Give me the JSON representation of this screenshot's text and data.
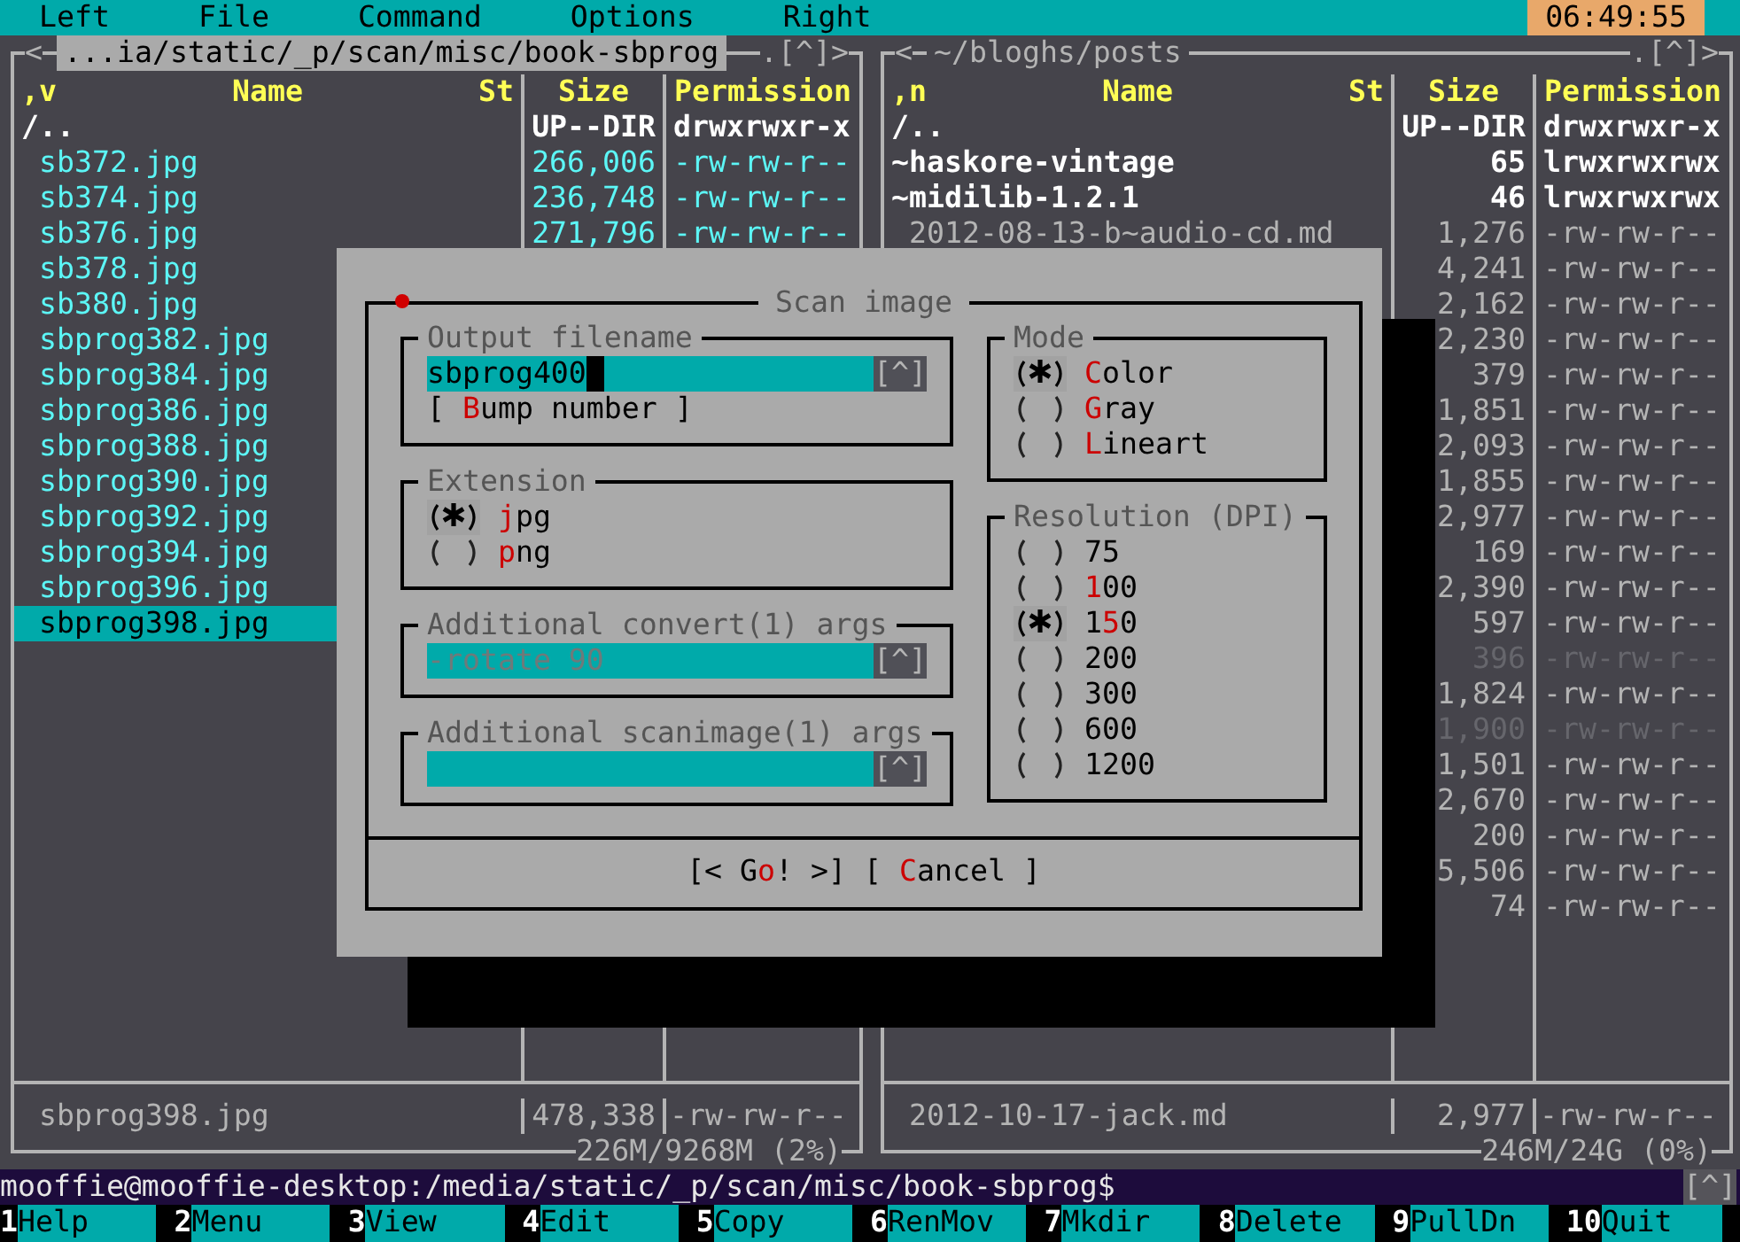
{
  "menu_bar": {
    "items": [
      "Left",
      "File",
      "Command",
      "Options",
      "Right"
    ],
    "clock": "06:49:55"
  },
  "panels": [
    {
      "active": true,
      "left_marker": "<",
      "path": "...ia/static/_p/scan/misc/book-sbprog",
      "right_marker": ".[^]>",
      "columns": {
        "sort": ",v",
        "name": "Name",
        "status": "St",
        "size": "Size",
        "permission": "Permission"
      },
      "rows": [
        {
          "kind": "dir",
          "name": "/..",
          "size": "UP--DIR",
          "permission": "drwxrwxr-x",
          "selected": false
        },
        {
          "kind": "image",
          "name": "sb372.jpg",
          "size": "266,006",
          "permission": "-rw-rw-r--",
          "selected": false
        },
        {
          "kind": "image",
          "name": "sb374.jpg",
          "size": "236,748",
          "permission": "-rw-rw-r--",
          "selected": false
        },
        {
          "kind": "image",
          "name": "sb376.jpg",
          "size": "271,796",
          "permission": "-rw-rw-r--",
          "selected": false
        },
        {
          "kind": "image",
          "name": "sb378.jpg",
          "selected": false
        },
        {
          "kind": "image",
          "name": "sb380.jpg",
          "selected": false
        },
        {
          "kind": "image",
          "name": "sbprog382.jpg",
          "selected": false
        },
        {
          "kind": "image",
          "name": "sbprog384.jpg",
          "selected": false
        },
        {
          "kind": "image",
          "name": "sbprog386.jpg",
          "selected": false
        },
        {
          "kind": "image",
          "name": "sbprog388.jpg",
          "selected": false
        },
        {
          "kind": "image",
          "name": "sbprog390.jpg",
          "selected": false
        },
        {
          "kind": "image",
          "name": "sbprog392.jpg",
          "selected": false
        },
        {
          "kind": "image",
          "name": "sbprog394.jpg",
          "selected": false
        },
        {
          "kind": "image",
          "name": "sbprog396.jpg",
          "selected": false
        },
        {
          "kind": "image",
          "name": "sbprog398.jpg",
          "selected": true
        }
      ],
      "info": {
        "name": "sbprog398.jpg",
        "size": "478,338",
        "permission": "-rw-rw-r--"
      },
      "disk_usage": "226M/9268M (2%)"
    },
    {
      "active": false,
      "left_marker": "<",
      "path": "~/bloghs/posts",
      "right_marker": ".[^]>",
      "columns": {
        "sort": ",n",
        "name": "Name",
        "status": "St",
        "size": "Size",
        "permission": "Permission"
      },
      "rows": [
        {
          "kind": "dir",
          "name": "/..",
          "size": "UP--DIR",
          "permission": "drwxrwxr-x",
          "selected": false
        },
        {
          "kind": "link",
          "name": "~haskore-vintage",
          "size": "65",
          "permission": "lrwxrwxrwx",
          "selected": false
        },
        {
          "kind": "link",
          "name": "~midilib-1.2.1",
          "size": "46",
          "permission": "lrwxrwxrwx",
          "selected": false
        },
        {
          "kind": "doc",
          "name": "2012-08-13-b~audio-cd.md",
          "size": "1,276",
          "permission": "-rw-rw-r--",
          "selected": false
        },
        {
          "kind": "doc",
          "size": "4,241",
          "permission": "-rw-rw-r--",
          "selected": false
        },
        {
          "kind": "doc",
          "size": "2,162",
          "permission": "-rw-rw-r--",
          "selected": false
        },
        {
          "kind": "doc",
          "size": "2,230",
          "permission": "-rw-rw-r--",
          "selected": false
        },
        {
          "kind": "doc",
          "size": "379",
          "permission": "-rw-rw-r--",
          "selected": false
        },
        {
          "kind": "doc",
          "size": "1,851",
          "permission": "-rw-rw-r--",
          "selected": false
        },
        {
          "kind": "doc",
          "size": "2,093",
          "permission": "-rw-rw-r--",
          "selected": false
        },
        {
          "kind": "doc",
          "size": "1,855",
          "permission": "-rw-rw-r--",
          "selected": false
        },
        {
          "kind": "doc",
          "size": "2,977",
          "permission": "-rw-rw-r--",
          "selected": false
        },
        {
          "kind": "doc",
          "size": "169",
          "permission": "-rw-rw-r--",
          "selected": false
        },
        {
          "kind": "doc",
          "size": "2,390",
          "permission": "-rw-rw-r--",
          "selected": false
        },
        {
          "kind": "doc",
          "size": "597",
          "permission": "-rw-rw-r--",
          "selected": false
        },
        {
          "kind": "backup",
          "size": "396",
          "permission": "-rw-rw-r--",
          "selected": false
        },
        {
          "kind": "doc",
          "size": "1,824",
          "permission": "-rw-rw-r--",
          "selected": false
        },
        {
          "kind": "backup",
          "size": "1,900",
          "permission": "-rw-rw-r--",
          "selected": false
        },
        {
          "kind": "doc",
          "size": "1,501",
          "permission": "-rw-rw-r--",
          "selected": false
        },
        {
          "kind": "doc",
          "size": "2,670",
          "permission": "-rw-rw-r--",
          "selected": false
        },
        {
          "kind": "doc",
          "size": "200",
          "permission": "-rw-rw-r--",
          "selected": false
        },
        {
          "kind": "doc",
          "size": "5,506",
          "permission": "-rw-rw-r--",
          "selected": false
        },
        {
          "kind": "doc",
          "size": "74",
          "permission": "-rw-rw-r--",
          "selected": false
        }
      ],
      "info": {
        "name": "2012-10-17-jack.md",
        "size": "2,977",
        "permission": "-rw-rw-r--"
      },
      "disk_usage": "246M/24G (0%)"
    }
  ],
  "dialog": {
    "title": "Scan image",
    "columns": [
      {
        "sections": [
          {
            "kind": "input",
            "title": "Output filename",
            "value": "sbprog400",
            "focused": true,
            "disabled": false,
            "history_button": "[^]",
            "button": {
              "pre": "[ ",
              "key": "B",
              "post": "ump number ]"
            }
          },
          {
            "kind": "radio",
            "title": "Extension",
            "options": [
              {
                "key": "j",
                "post": "pg",
                "selected": true
              },
              {
                "key": "p",
                "post": "ng",
                "selected": false
              }
            ]
          },
          {
            "kind": "input",
            "title": "Additional convert(1) args",
            "value": "-rotate 90",
            "focused": false,
            "disabled": true,
            "history_button": "[^]"
          },
          {
            "kind": "input",
            "title": "Additional scanimage(1) args",
            "focused": false,
            "history_button": "[^]"
          }
        ]
      },
      {
        "sections": [
          {
            "kind": "radio",
            "title": "Mode",
            "options": [
              {
                "key": "C",
                "post": "olor",
                "selected": true
              },
              {
                "key": "G",
                "post": "ray",
                "selected": false
              },
              {
                "key": "L",
                "post": "ineart",
                "selected": false
              }
            ]
          },
          {
            "kind": "radio",
            "title": "Resolution (DPI)",
            "options": [
              {
                "pre": "75",
                "selected": false
              },
              {
                "key": "1",
                "post": "00",
                "selected": false
              },
              {
                "pre": "1",
                "key": "5",
                "post": "0",
                "selected": true
              },
              {
                "pre": "200",
                "selected": false
              },
              {
                "pre": "300",
                "selected": false
              },
              {
                "pre": "600",
                "selected": false
              },
              {
                "pre": "1200",
                "selected": false
              }
            ]
          }
        ]
      }
    ],
    "buttons": [
      {
        "pre": "[< G",
        "key": "o",
        "post": "! >]"
      },
      {
        "pre": "[ ",
        "key": "C",
        "post": "ancel ]"
      }
    ]
  },
  "command_line": {
    "prompt": "mooffie@mooffie-desktop:/media/static/_p/scan/misc/book-sbprog$",
    "history_button": "[^]"
  },
  "key_bar": [
    {
      "key": "1",
      "label": "Help"
    },
    {
      "key": "2",
      "label": "Menu"
    },
    {
      "key": "3",
      "label": "View"
    },
    {
      "key": "4",
      "label": "Edit"
    },
    {
      "key": "5",
      "label": "Copy"
    },
    {
      "key": "6",
      "label": "RenMov"
    },
    {
      "key": "7",
      "label": "Mkdir"
    },
    {
      "key": "8",
      "label": "Delete"
    },
    {
      "key": "9",
      "label": "PullDn"
    },
    {
      "key": "10",
      "label": "Quit"
    }
  ]
}
